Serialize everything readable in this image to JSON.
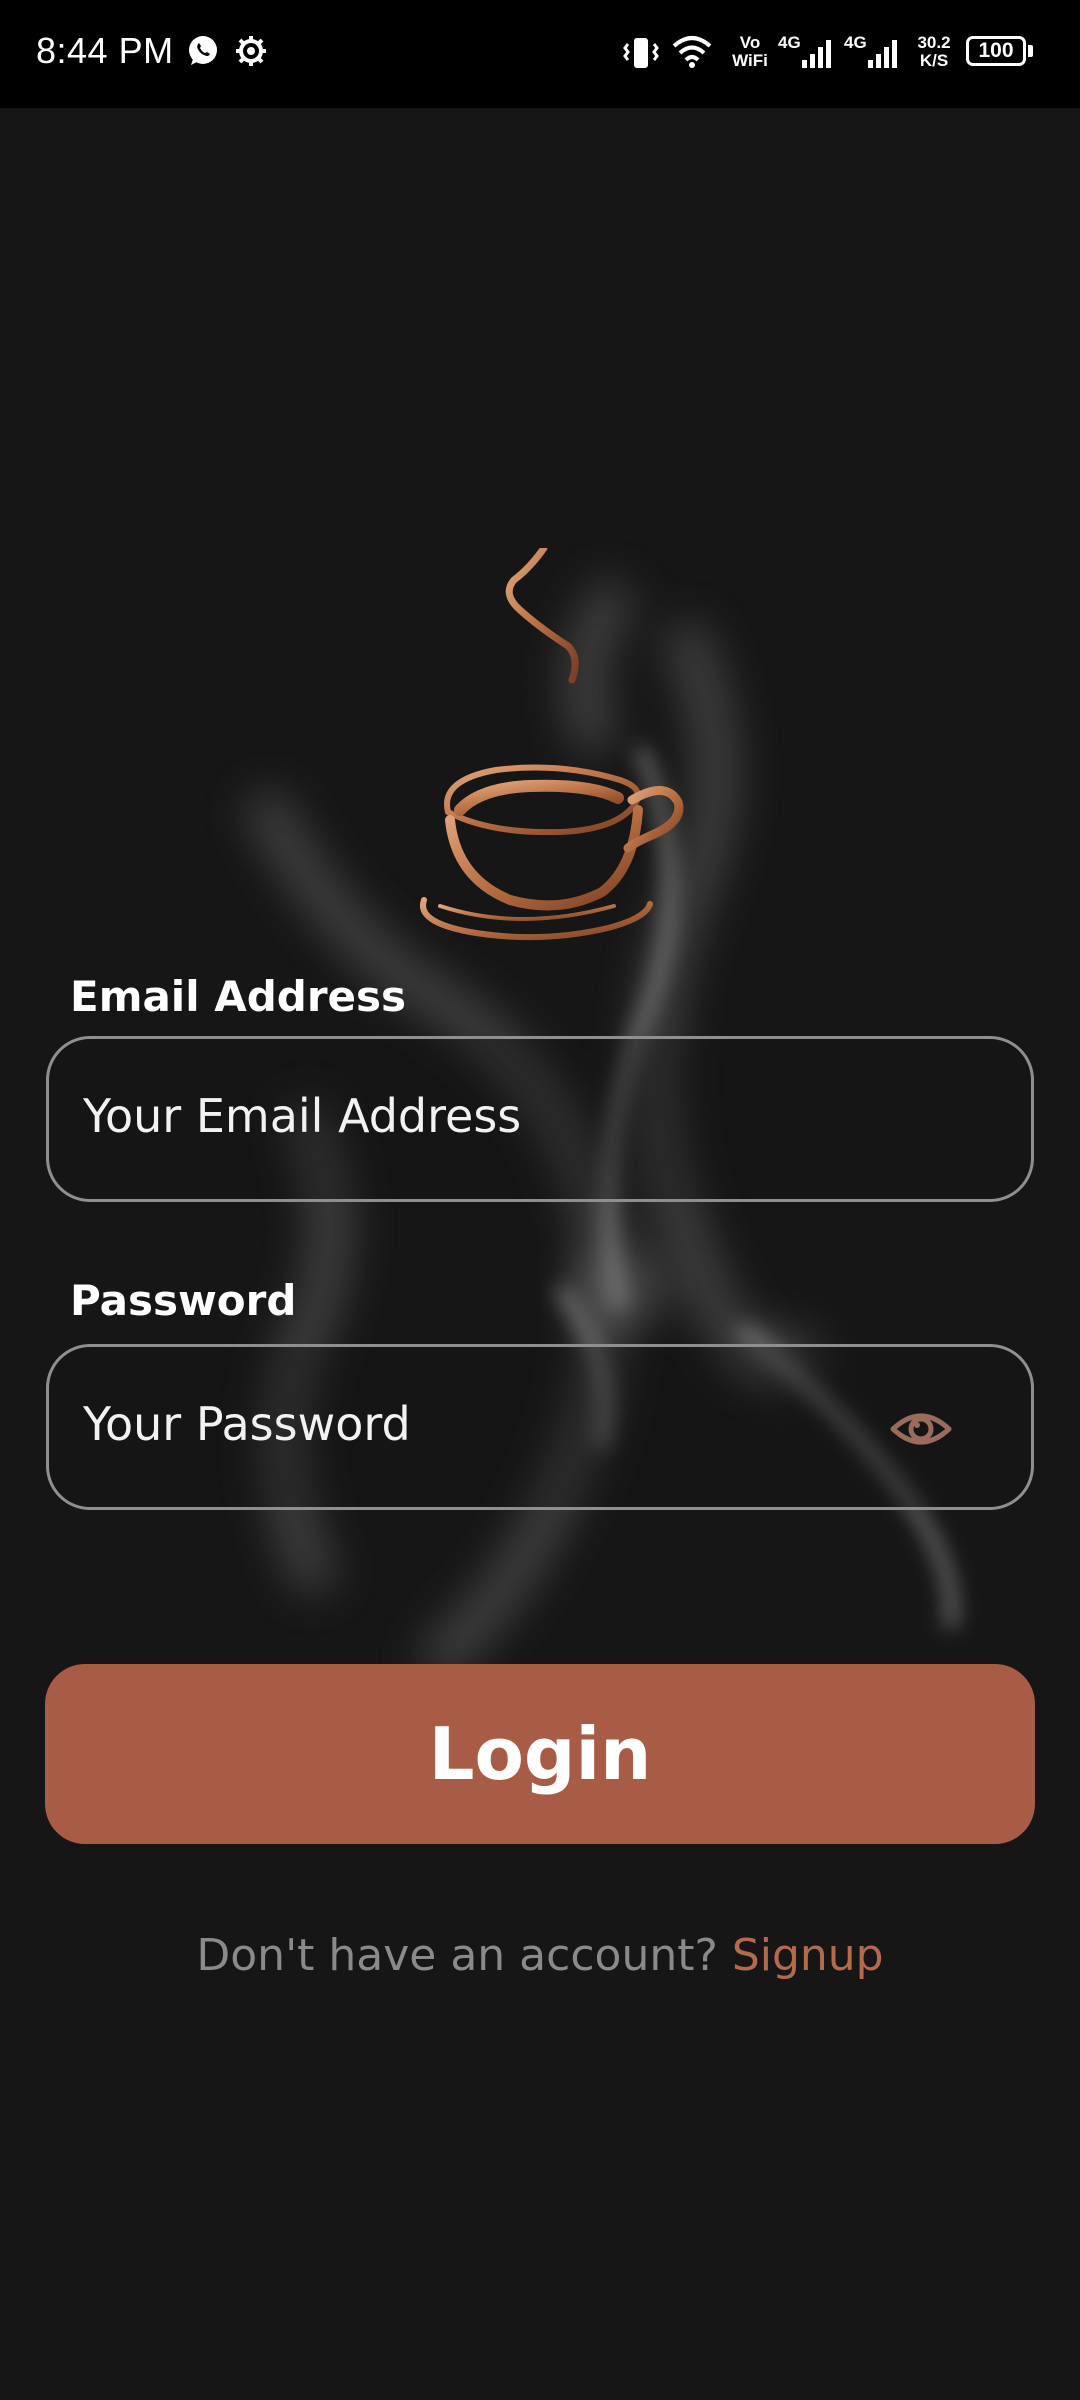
{
  "status_bar": {
    "time": "8:44 PM",
    "icons": [
      "whatsapp-icon",
      "settings-gear-icon",
      "vibrate-icon",
      "wifi-icon",
      "signal-icon",
      "signal-icon"
    ],
    "vowifi_top": "Vo",
    "vowifi_bottom": "WiFi",
    "network_1": "4G",
    "network_2": "4G",
    "speed_value": "30.2",
    "speed_unit": "K/S",
    "battery": "100"
  },
  "login": {
    "logo_icon": "coffee-cup-icon",
    "email_label": "Email Address",
    "email_placeholder": "Your Email Address",
    "password_label": "Password",
    "password_placeholder": "Your Password",
    "password_toggle_icon": "eye-icon",
    "login_button": "Login",
    "signup_prompt": "Don't have an account?",
    "signup_link": "Signup"
  },
  "colors": {
    "background": "#161616",
    "accent": "#a95c45",
    "link": "#b5694d",
    "logo_copper": "#c07a52",
    "field_border": "#8f8f8f"
  }
}
